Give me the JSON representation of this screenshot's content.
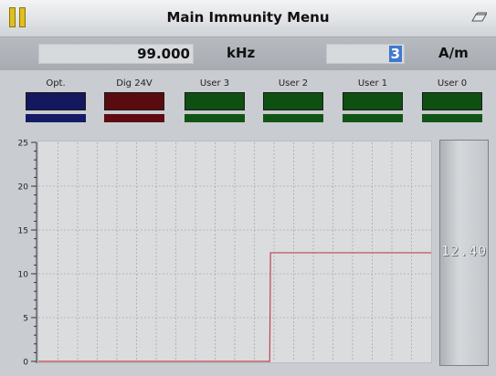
{
  "header": {
    "title": "Main Immunity Menu",
    "pause_icon": "pause-icon",
    "right_icon": "eraser-icon"
  },
  "frequency": {
    "value": "99.000",
    "unit": "kHz"
  },
  "amplitude": {
    "value": "3",
    "unit": "A/m"
  },
  "channels": [
    {
      "label": "Opt.",
      "box_color": "#14185e",
      "bar_color": "#161b66"
    },
    {
      "label": "Dig 24V",
      "box_color": "#5a0b10",
      "bar_color": "#5e0c12"
    },
    {
      "label": "User 3",
      "box_color": "#0e4f12",
      "bar_color": "#115516"
    },
    {
      "label": "User 2",
      "box_color": "#0e4f12",
      "bar_color": "#115516"
    },
    {
      "label": "User 1",
      "box_color": "#0e4f12",
      "bar_color": "#115516"
    },
    {
      "label": "User 0",
      "box_color": "#0e4f12",
      "bar_color": "#115516"
    }
  ],
  "readout": {
    "value": "12.40"
  },
  "chart_data": {
    "type": "line",
    "ylim": [
      0,
      25
    ],
    "yticks": [
      "0",
      "5",
      "10",
      "15",
      "20",
      "25"
    ],
    "series": [
      {
        "color": "#c0444f",
        "x": [
          0,
          0.589,
          0.591,
          1.0
        ],
        "values": [
          0,
          0,
          12.4,
          12.4
        ]
      }
    ],
    "grid": true
  }
}
